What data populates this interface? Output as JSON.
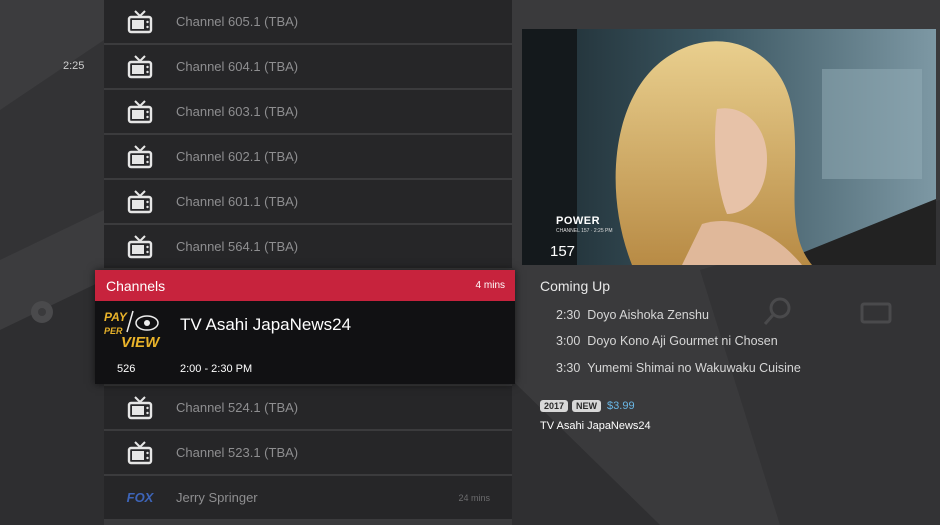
{
  "guide": {
    "time_marker": "2:25",
    "rows_above": [
      {
        "name": "Channel 605.1 (TBA)",
        "icon": "tv-icon"
      },
      {
        "name": "Channel 604.1 (TBA)",
        "icon": "tv-icon"
      },
      {
        "name": "Channel 603.1 (TBA)",
        "icon": "tv-icon"
      },
      {
        "name": "Channel 602.1 (TBA)",
        "icon": "tv-icon"
      },
      {
        "name": "Channel 601.1 (TBA)",
        "icon": "tv-icon"
      },
      {
        "name": "Channel 564.1 (TBA)",
        "icon": "tv-icon"
      }
    ],
    "selected": {
      "header_title": "Channels",
      "header_mins": "4 mins",
      "program": "TV Asahi JapaNews24",
      "channel_number": "526",
      "time_range": "2:00 - 2:30 PM",
      "logo": "pay-per-view-logo",
      "logo_lines": [
        "PAY",
        "PER",
        "VIEW"
      ]
    },
    "rows_below": [
      {
        "name": "Channel 524.1 (TBA)",
        "icon": "tv-icon",
        "mins": ""
      },
      {
        "name": "Channel 523.1 (TBA)",
        "icon": "tv-icon",
        "mins": ""
      },
      {
        "name": "Jerry Springer",
        "icon": "fox-logo",
        "logo_text": "FOX",
        "mins": "24 mins"
      }
    ]
  },
  "preview": {
    "overlay_logo": "POWER",
    "overlay_small": "CHANNEL 157 · 2:25 PM",
    "overlay_channel": "157"
  },
  "coming_up": {
    "title": "Coming Up",
    "items": [
      {
        "time": "2:30",
        "title": "Doyo Aishoka Zenshu"
      },
      {
        "time": "3:00",
        "title": "Doyo Kono Aji Gourmet ni Chosen"
      },
      {
        "time": "3:30",
        "title": "Yumemi Shimai no Wakuwaku Cuisine"
      }
    ]
  },
  "details": {
    "year_badge": "2017",
    "new_badge": "NEW",
    "price": "$3.99",
    "channel_name": "TV Asahi JapaNews24"
  },
  "colors": {
    "accent": "#c7233d",
    "background": "#3a3a3c",
    "row_bg": "#262628",
    "selected_bg": "#111113",
    "price": "#6ab7e6"
  }
}
